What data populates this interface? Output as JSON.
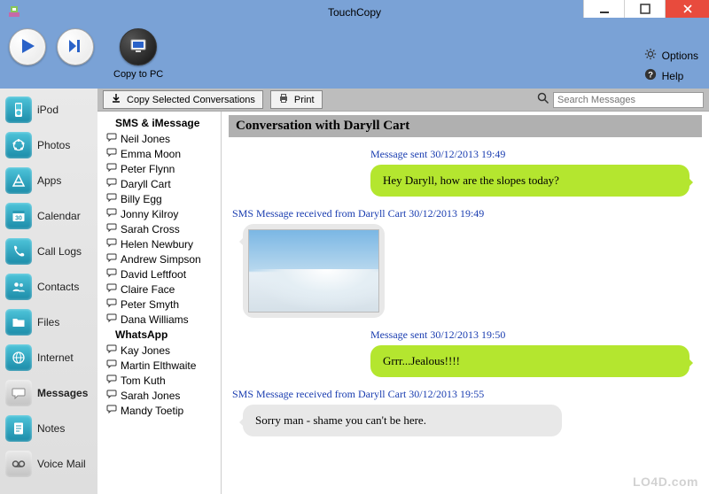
{
  "window": {
    "title": "TouchCopy"
  },
  "toolbar": {
    "copy_to_pc_label": "Copy to PC",
    "options_label": "Options",
    "help_label": "Help"
  },
  "sidebar": {
    "items": [
      {
        "label": "iPod"
      },
      {
        "label": "Photos"
      },
      {
        "label": "Apps"
      },
      {
        "label": "Calendar"
      },
      {
        "label": "Call Logs"
      },
      {
        "label": "Contacts"
      },
      {
        "label": "Files"
      },
      {
        "label": "Internet"
      },
      {
        "label": "Messages"
      },
      {
        "label": "Notes"
      },
      {
        "label": "Voice Mail"
      }
    ]
  },
  "actions": {
    "copy_selected_label": "Copy Selected Conversations",
    "print_label": "Print",
    "search_placeholder": "Search Messages"
  },
  "contacts": {
    "group1_header": "SMS & iMessage",
    "group1": [
      "Neil Jones",
      "Emma Moon",
      "Peter Flynn",
      "Daryll Cart",
      "Billy Egg",
      "Jonny Kilroy",
      "Sarah Cross",
      "Helen Newbury",
      "Andrew Simpson",
      "David Leftfoot",
      "Claire Face",
      "Peter Smyth",
      "Dana Williams"
    ],
    "group2_header": "WhatsApp",
    "group2": [
      "Kay Jones",
      "Martin Elthwaite",
      "Tom Kuth",
      "Sarah Jones",
      "Mandy Toetip"
    ]
  },
  "conversation": {
    "title": "Conversation with Daryll Cart",
    "messages": [
      {
        "dir": "sent",
        "meta": "Message sent 30/12/2013 19:49",
        "body": "Hey Daryll, how are the slopes today?"
      },
      {
        "dir": "recv",
        "meta": "SMS Message received from Daryll Cart 30/12/2013 19:49",
        "image": true
      },
      {
        "dir": "sent",
        "meta": "Message sent 30/12/2013 19:50",
        "body": "Grrr...Jealous!!!!"
      },
      {
        "dir": "recv",
        "meta": "SMS Message received from Daryll Cart 30/12/2013 19:55",
        "body": "Sorry man - shame you can't be here."
      }
    ]
  },
  "watermark": "LO4D.com"
}
